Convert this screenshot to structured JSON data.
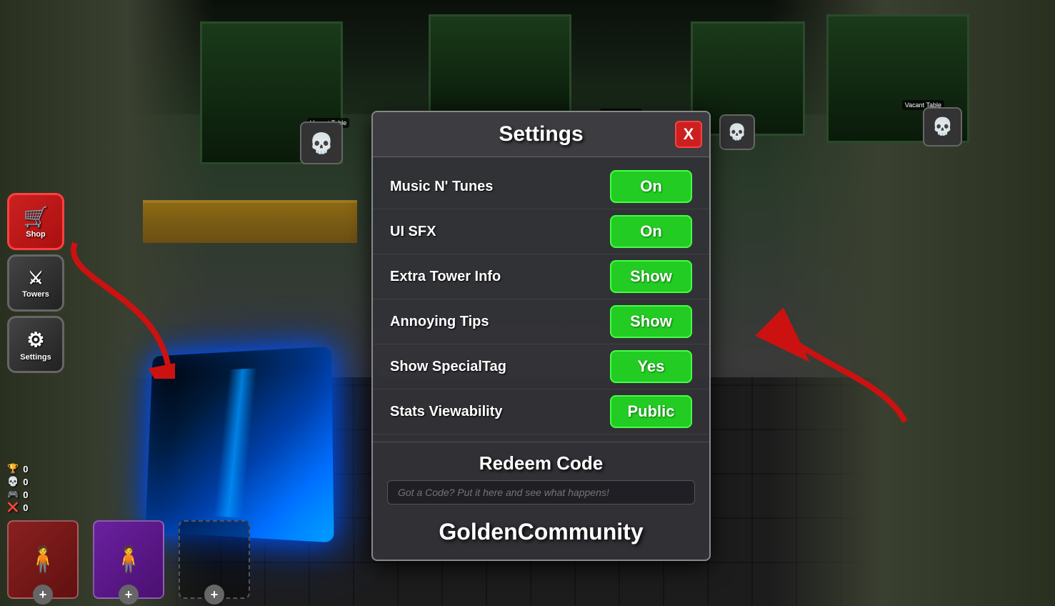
{
  "modal": {
    "title": "Settings",
    "close_btn": "X",
    "settings": [
      {
        "label": "Music N' Tunes",
        "value": "On"
      },
      {
        "label": "UI SFX",
        "value": "On"
      },
      {
        "label": "Extra Tower Info",
        "value": "Show"
      },
      {
        "label": "Annoying Tips",
        "value": "Show"
      },
      {
        "label": "Show SpecialTag",
        "value": "Yes"
      },
      {
        "label": "Stats Viewability",
        "value": "Public"
      }
    ],
    "redeem": {
      "title": "Redeem Code",
      "placeholder": "Got a Code? Put it here and see what happens!",
      "code": "GoldenCommunity"
    }
  },
  "sidebar": {
    "items": [
      {
        "label": "Shop",
        "icon": "🛒"
      },
      {
        "label": "Towers",
        "icon": "⚔"
      },
      {
        "label": "Settings",
        "icon": "⚙"
      }
    ]
  },
  "stats": [
    {
      "icon": "🏆",
      "value": "0"
    },
    {
      "icon": "💀",
      "value": "0"
    },
    {
      "icon": "🎮",
      "value": "0"
    },
    {
      "icon": "❌",
      "value": "0"
    }
  ],
  "chars": [
    {
      "bg": "red",
      "icon": "🧍"
    },
    {
      "bg": "purple",
      "icon": "🧍"
    }
  ],
  "colors": {
    "toggle_green": "#22cc22",
    "close_red": "#cc2020",
    "modal_bg": "rgba(50,50,55,0.95)"
  }
}
